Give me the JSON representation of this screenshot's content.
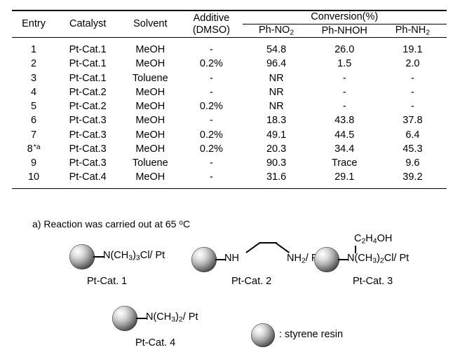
{
  "table": {
    "headers": {
      "entry": "Entry",
      "catalyst": "Catalyst",
      "solvent": "Solvent",
      "additive_line1": "Additive",
      "additive_line2": "(DMSO)",
      "conversion_group": "Conversion(%)",
      "conv_1_pre": "Ph-NO",
      "conv_1_sub": "2",
      "conv_2": "Ph-NHOH",
      "conv_3_pre": "Ph-NH",
      "conv_3_sub": "2"
    },
    "rows": [
      {
        "entry": "1",
        "entry_note": "",
        "catalyst": "Pt-Cat.1",
        "solvent": "MeOH",
        "additive": "-",
        "phno2": "54.8",
        "phnhoh": "26.0",
        "phnh2": "19.1"
      },
      {
        "entry": "2",
        "entry_note": "",
        "catalyst": "Pt-Cat.1",
        "solvent": "MeOH",
        "additive": "0.2%",
        "phno2": "96.4",
        "phnhoh": "1.5",
        "phnh2": "2.0"
      },
      {
        "entry": "3",
        "entry_note": "",
        "catalyst": "Pt-Cat.1",
        "solvent": "Toluene",
        "additive": "-",
        "phno2": "NR",
        "phnhoh": "-",
        "phnh2": "-"
      },
      {
        "entry": "4",
        "entry_note": "",
        "catalyst": "Pt-Cat.2",
        "solvent": "MeOH",
        "additive": "-",
        "phno2": "NR",
        "phnhoh": "-",
        "phnh2": "-"
      },
      {
        "entry": "5",
        "entry_note": "",
        "catalyst": "Pt-Cat.2",
        "solvent": "MeOH",
        "additive": "0.2%",
        "phno2": "NR",
        "phnhoh": "-",
        "phnh2": "-"
      },
      {
        "entry": "6",
        "entry_note": "",
        "catalyst": "Pt-Cat.3",
        "solvent": "MeOH",
        "additive": "-",
        "phno2": "18.3",
        "phnhoh": "43.8",
        "phnh2": "37.8"
      },
      {
        "entry": "7",
        "entry_note": "",
        "catalyst": "Pt-Cat.3",
        "solvent": "MeOH",
        "additive": "0.2%",
        "phno2": "49.1",
        "phnhoh": "44.5",
        "phnh2": "6.4"
      },
      {
        "entry": "8",
        "entry_note": "*a",
        "catalyst": "Pt-Cat.3",
        "solvent": "MeOH",
        "additive": "0.2%",
        "phno2": "20.3",
        "phnhoh": "34.4",
        "phnh2": "45.3"
      },
      {
        "entry": "9",
        "entry_note": "",
        "catalyst": "Pt-Cat.3",
        "solvent": "Toluene",
        "additive": "-",
        "phno2": "90.3",
        "phnhoh": "Trace",
        "phnh2": "9.6"
      },
      {
        "entry": "10",
        "entry_note": "",
        "catalyst": "Pt-Cat.4",
        "solvent": "MeOH",
        "additive": "-",
        "phno2": "31.6",
        "phnhoh": "29.1",
        "phnh2": "39.2"
      }
    ]
  },
  "footnote": {
    "prefix": "a) Reaction was carried out at 65 ",
    "degree": "o",
    "suffix": "C"
  },
  "structures": {
    "cat1": {
      "caption": "Pt-Cat. 1",
      "f_pre": "N(CH",
      "f_sub1": "3",
      "f_mid": ")",
      "f_sub2": "3",
      "f_post": "Cl/ Pt"
    },
    "cat2": {
      "caption": "Pt-Cat. 2",
      "left_group": "NH",
      "right_pre": "NH",
      "right_sub": "2",
      "right_post": "/ Pt"
    },
    "cat3": {
      "caption": "Pt-Cat. 3",
      "top_pre": "C",
      "top_sub1": "2",
      "top_mid": "H",
      "top_sub2": "4",
      "top_post": "OH",
      "f_pre": "N(CH",
      "f_sub1": "3",
      "f_mid": ")",
      "f_sub2": "2",
      "f_post": "Cl/ Pt"
    },
    "cat4": {
      "caption": "Pt-Cat. 4",
      "f_pre": "N(CH",
      "f_sub1": "3",
      "f_mid": ")",
      "f_sub2": "2",
      "f_post": "/ Pt"
    },
    "legend": {
      "label": ": styrene resin"
    }
  },
  "colors": {
    "text": "#000000",
    "rule": "#000000",
    "background": "#ffffff"
  }
}
